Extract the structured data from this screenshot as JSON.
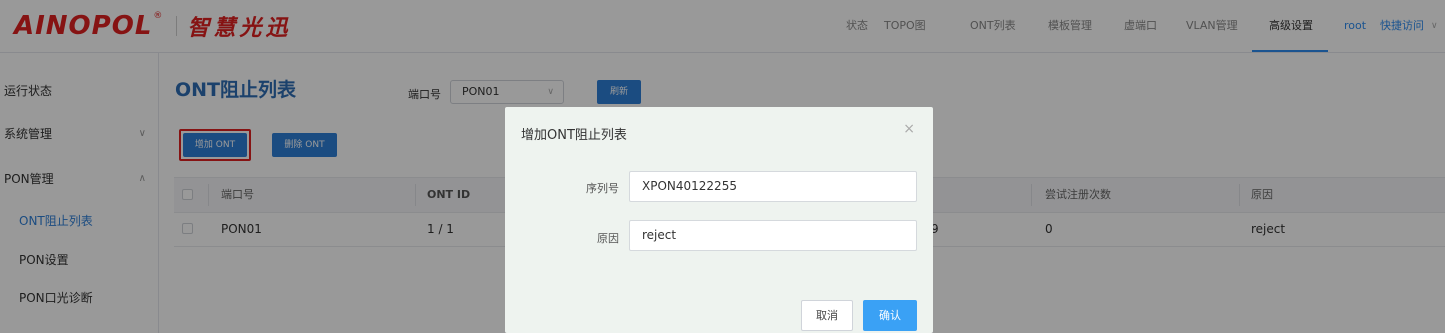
{
  "header": {
    "logo_text": "AINOPOL",
    "logo_reg": "®",
    "logo_cn": "智慧光迅",
    "nav": [
      "状态",
      "TOPO图",
      "ONT列表",
      "模板管理",
      "虚端口",
      "VLAN管理",
      "高级设置"
    ],
    "active_nav": "高级设置",
    "user": "root",
    "quick_access": "快捷访问",
    "quick_access_chevron": "∨"
  },
  "sidebar": {
    "items": [
      {
        "label": "运行状态",
        "chevron": ""
      },
      {
        "label": "系统管理",
        "chevron": "∨"
      },
      {
        "label": "PON管理",
        "chevron": "∧"
      },
      {
        "label": "ONT阻止列表",
        "chevron": ""
      },
      {
        "label": "PON设置",
        "chevron": ""
      },
      {
        "label": "PON口光诊断",
        "chevron": ""
      }
    ]
  },
  "main": {
    "title": "ONT阻止列表",
    "port_label": "端口号",
    "port_value": "PON01",
    "port_chevron": "∨",
    "refresh_label": "刷新",
    "add_label": "增加 ONT",
    "delete_label": "删除 ONT",
    "table": {
      "headers": [
        "端口号",
        "ONT ID",
        "尝试注册次数",
        "原因"
      ],
      "rows": [
        {
          "port": "PON01",
          "ont_id": "1 / 1",
          "partial": "9",
          "count": "0",
          "reason": "reject"
        }
      ]
    }
  },
  "modal": {
    "title": "增加ONT阻止列表",
    "close": "×",
    "serial_label": "序列号",
    "serial_value": "XPON40122255",
    "reason_label": "原因",
    "reason_value": "reject",
    "cancel_label": "取消",
    "ok_label": "确认"
  },
  "colors": {
    "accent": "#2d7fd8",
    "brand_red": "#e02020",
    "title_blue": "#2d6db5",
    "confirm_blue": "#3aa1f5"
  }
}
